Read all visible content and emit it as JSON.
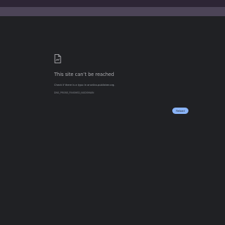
{
  "colors": {
    "page_background": "#202124",
    "title_strip": "#2d2535",
    "toolbar": "#4c4457",
    "accent": "#8ab4f8",
    "title_text": "#aeaeb2",
    "body_text": "#9aa0a6"
  },
  "error": {
    "icon": "broken-page-icon",
    "title": "This site can’t be reached",
    "suggestion": "Check if there is a typo in arunika-publisher.org.",
    "code": "DNS_PROBE_FINISHED_NXDOMAIN"
  },
  "actions": {
    "reload_label": "Reload"
  }
}
